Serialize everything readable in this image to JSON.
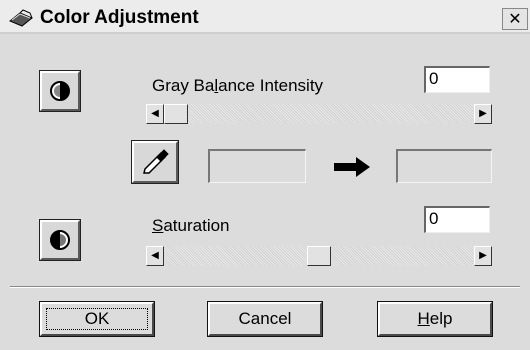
{
  "window": {
    "title": "Color Adjustment",
    "close_glyph": "✕"
  },
  "gray_balance": {
    "label_pre": "Gray Ba",
    "label_mnemonic": "l",
    "label_post": "ance Intensity",
    "value": "0",
    "slider_fraction": 0.0
  },
  "color_picker": {
    "icon": "eyedropper-icon",
    "arrow_icon": "right-arrow-icon"
  },
  "saturation": {
    "label_mnemonic": "S",
    "label_post": "aturation",
    "value": "0",
    "slider_fraction": 0.5
  },
  "buttons": {
    "ok_label": "OK",
    "cancel_label": "Cancel",
    "help_mnemonic": "H",
    "help_post": "elp"
  },
  "icons": {
    "title": "scanner-icon",
    "gray_balance": "gray-balance-icon",
    "saturation": "saturation-icon"
  }
}
